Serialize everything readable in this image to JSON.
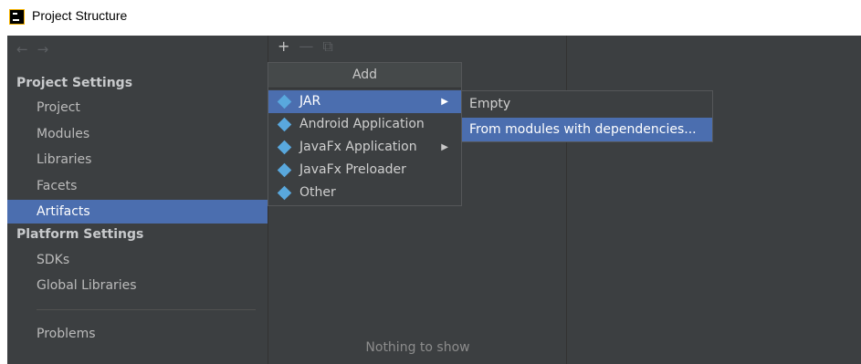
{
  "window": {
    "title": "Project Structure"
  },
  "nav": {
    "back": "←",
    "forward": "→"
  },
  "sidebar": {
    "project_settings_header": "Project Settings",
    "project_items": [
      "Project",
      "Modules",
      "Libraries",
      "Facets",
      "Artifacts"
    ],
    "selected": "Artifacts",
    "platform_settings_header": "Platform Settings",
    "platform_items": [
      "SDKs",
      "Global Libraries"
    ],
    "problems": "Problems"
  },
  "toolbar": {
    "add": "+",
    "remove": "—",
    "copy": "⧉"
  },
  "middle": {
    "empty_text": "Nothing to show"
  },
  "add_popup": {
    "title": "Add",
    "items": [
      "JAR",
      "Android Application",
      "JavaFx Application",
      "JavaFx Preloader",
      "Other"
    ],
    "submenu_arrow": "▶"
  },
  "jar_submenu": {
    "items": [
      "Empty",
      "From modules with dependencies..."
    ]
  },
  "colors": {
    "selection": "#4b6eaf",
    "background": "#3c3f41",
    "artifact_icon": "#59a8dd"
  }
}
